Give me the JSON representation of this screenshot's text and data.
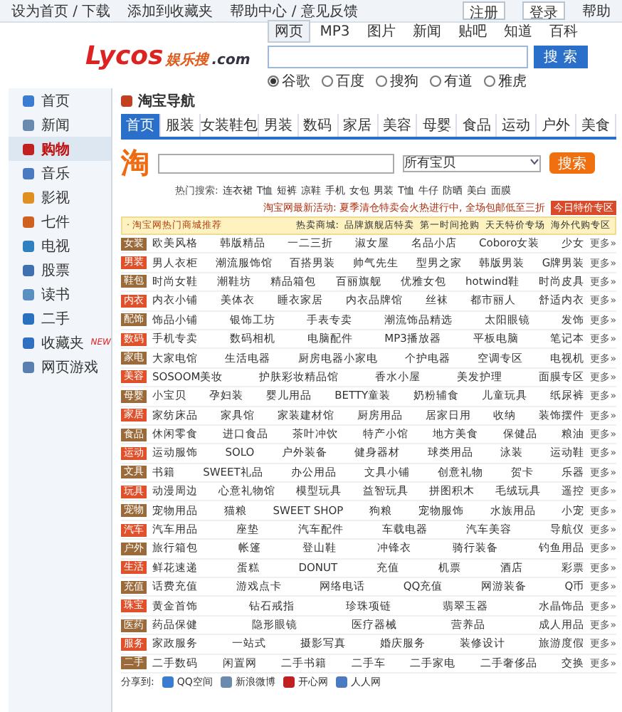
{
  "top_links": [
    "设为首页 / 下载",
    "添加到收藏夹",
    "帮助中心 / 意见反馈"
  ],
  "account_buttons": [
    "注册",
    "登录"
  ],
  "help": "帮助",
  "logo": {
    "word": "Lycos",
    "cn": "娱乐搜",
    "domain": ".com"
  },
  "search_tabs": [
    {
      "label": "网页",
      "selected": true
    },
    {
      "label": "MP3",
      "selected": false
    },
    {
      "label": "图片",
      "selected": false
    },
    {
      "label": "新闻",
      "selected": false
    },
    {
      "label": "贴吧",
      "selected": false
    },
    {
      "label": "知道",
      "selected": false
    },
    {
      "label": "百科",
      "selected": false
    }
  ],
  "search_button": "搜 索",
  "engines": [
    {
      "label": "谷歌",
      "selected": true
    },
    {
      "label": "百度",
      "selected": false
    },
    {
      "label": "搜狗",
      "selected": false
    },
    {
      "label": "有道",
      "selected": false
    },
    {
      "label": "雅虎",
      "selected": false
    }
  ],
  "sidebar": [
    {
      "label": "首页",
      "selected": false
    },
    {
      "label": "新闻",
      "selected": false
    },
    {
      "label": "购物",
      "selected": true
    },
    {
      "label": "音乐",
      "selected": false
    },
    {
      "label": "影视",
      "selected": false
    },
    {
      "label": "七件",
      "selected": false
    },
    {
      "label": "电视",
      "selected": false
    },
    {
      "label": "股票",
      "selected": false
    },
    {
      "label": "读书",
      "selected": false
    },
    {
      "label": "二手",
      "selected": false
    },
    {
      "label": "收藏夹",
      "selected": false,
      "badge": "NEW"
    },
    {
      "label": "网页游戏",
      "selected": false
    }
  ],
  "page_title": "淘宝导航",
  "category_tabs": [
    {
      "label": "首页",
      "selected": true
    },
    {
      "label": "服装",
      "selected": false
    },
    {
      "label": "女装鞋包",
      "selected": false
    },
    {
      "label": "男装",
      "selected": false
    },
    {
      "label": "数码",
      "selected": false
    },
    {
      "label": "家居",
      "selected": false
    },
    {
      "label": "美容",
      "selected": false
    },
    {
      "label": "母婴",
      "selected": false
    },
    {
      "label": "食品",
      "selected": false
    },
    {
      "label": "运动",
      "selected": false
    },
    {
      "label": "户外",
      "selected": false
    },
    {
      "label": "美食",
      "selected": false
    }
  ],
  "taobao": {
    "logo": "淘",
    "select": "所有宝贝",
    "button": "搜索",
    "hot_words": [
      "热门搜索:",
      "连衣裙",
      "T恤",
      "短裤",
      "凉鞋",
      "手机",
      "女包",
      "男装",
      "T恤",
      "牛仔",
      "防晒",
      "美白",
      "面膜"
    ]
  },
  "notice": {
    "text": "淘宝网最新活动: 夏季清仓特卖会火热进行中, 全场包邮低至三折",
    "tag": "今日特价专区"
  },
  "hot_bar": {
    "title": "· 淘宝网热门商城推荐",
    "links": [
      "热卖商城:",
      "品牌旗舰店特卖",
      "第一时间抢购",
      "天天特价专场",
      "海外代购专区"
    ]
  },
  "rows": [
    {
      "category": "女装",
      "color": "#9a6a3a",
      "links": [
        "欧美风格",
        "韩版精品",
        "一二三折",
        "淑女屋",
        "名品小店",
        "Coboro女装",
        "少女"
      ],
      "more": "更多»"
    },
    {
      "category": "男装",
      "color": "#e0502a",
      "links": [
        "男人衣柜",
        "潮流服饰馆",
        "百搭男装",
        "帅气先生",
        "型男之家",
        "韩版男装",
        "G牌男装"
      ],
      "more": "更多»"
    },
    {
      "category": "鞋包",
      "color": "#9a6a3a",
      "links": [
        "时尚女鞋",
        "潮鞋坊",
        "精品箱包",
        "百丽旗舰",
        "优雅女包",
        "hotwind鞋",
        "时尚皮具"
      ],
      "more": "更多»"
    },
    {
      "category": "内衣",
      "color": "#e0502a",
      "links": [
        "内衣小铺",
        "美体衣",
        "睡衣家居",
        "内衣品牌馆",
        "丝袜",
        "都市丽人",
        "舒适内衣"
      ],
      "more": "更多»"
    },
    {
      "category": "配饰",
      "color": "#9a6a3a",
      "links": [
        "饰品小铺",
        "银饰工坊",
        "手表专卖",
        "潮流饰品精选",
        "太阳眼镜",
        "发饰"
      ],
      "more": "更多»"
    },
    {
      "category": "数码",
      "color": "#e0502a",
      "links": [
        "手机专卖",
        "数码相机",
        "电脑配件",
        "MP3播放器",
        "平板电脑",
        "笔记本"
      ],
      "more": "更多»"
    },
    {
      "category": "家电",
      "color": "#9a6a3a",
      "links": [
        "大家电馆",
        "生活电器",
        "厨房电器小家电",
        "个护电器",
        "空调专区",
        "电视机"
      ],
      "more": "更多»"
    },
    {
      "category": "美容",
      "color": "#e0502a",
      "links": [
        "SOSOOM美妆",
        "护肤彩妆精品馆",
        "香水小屋",
        "美发护理",
        "面膜专区"
      ],
      "more": "更多»"
    },
    {
      "category": "母婴",
      "color": "#9a6a3a",
      "links": [
        "小宝贝",
        "孕妇装",
        "婴儿用品",
        "BETTY童装",
        "奶粉辅食",
        "儿童玩具",
        "纸尿裤"
      ],
      "more": "更多»"
    },
    {
      "category": "家居",
      "color": "#e0502a",
      "links": [
        "家纺床品",
        "家具馆",
        "家装建材馆",
        "厨房用品",
        "居家日用",
        "收纳",
        "装饰摆件"
      ],
      "more": "更多»"
    },
    {
      "category": "食品",
      "color": "#9a6a3a",
      "links": [
        "休闲零食",
        "进口食品",
        "茶叶冲饮",
        "特产小馆",
        "地方美食",
        "保健品",
        "粮油"
      ],
      "more": "更多»"
    },
    {
      "category": "运动",
      "color": "#e0502a",
      "links": [
        "运动服饰",
        "SOLO",
        "户外装备",
        "健身器材",
        "球类用品",
        "泳装",
        "运动鞋"
      ],
      "more": "更多»"
    },
    {
      "category": "文具",
      "color": "#9a6a3a",
      "links": [
        "书籍",
        "SWEET礼品",
        "办公用品",
        "文具小铺",
        "创意礼物",
        "贺卡",
        "乐器"
      ],
      "more": "更多»"
    },
    {
      "category": "玩具",
      "color": "#e0502a",
      "links": [
        "动漫周边",
        "心意礼物馆",
        "模型玩具",
        "益智玩具",
        "拼图积木",
        "毛绒玩具",
        "遥控"
      ],
      "more": "更多»"
    },
    {
      "category": "宠物",
      "color": "#9a6a3a",
      "links": [
        "宠物用品",
        "猫粮",
        "SWEET SHOP",
        "狗粮",
        "宠物服饰",
        "水族用品",
        "小宠"
      ],
      "more": "更多»"
    },
    {
      "category": "汽车",
      "color": "#e0502a",
      "links": [
        "汽车用品",
        "座垫",
        "汽车配件",
        "车载电器",
        "汽车美容",
        "导航仪"
      ],
      "more": "更多»"
    },
    {
      "category": "户外",
      "color": "#9a6a3a",
      "links": [
        "旅行箱包",
        "帐篷",
        "登山鞋",
        "冲锋衣",
        "骑行装备",
        "钓鱼用品"
      ],
      "more": "更多»"
    },
    {
      "category": "生活",
      "color": "#e0502a",
      "links": [
        "鲜花速递",
        "蛋糕",
        "DONUT",
        "充值",
        "机票",
        "酒店",
        "彩票"
      ],
      "more": "更多»"
    },
    {
      "category": "充值",
      "color": "#9a6a3a",
      "links": [
        "话费充值",
        "游戏点卡",
        "网络电话",
        "QQ充值",
        "网游装备",
        "Q币"
      ],
      "more": "更多»"
    },
    {
      "category": "珠宝",
      "color": "#e0502a",
      "links": [
        "黄金首饰",
        "钻石戒指",
        "珍珠项链",
        "翡翠玉器",
        "水晶饰品"
      ],
      "more": "更多»"
    },
    {
      "category": "医药",
      "color": "#9a6a3a",
      "links": [
        "药品保健",
        "隐形眼镜",
        "医疗器械",
        "营养品",
        "成人用品"
      ],
      "more": "更多»"
    },
    {
      "category": "服务",
      "color": "#e0502a",
      "links": [
        "家政服务",
        "一站式",
        "摄影写真",
        "婚庆服务",
        "装修设计",
        "旅游度假"
      ],
      "more": "更多»"
    },
    {
      "category": "二手",
      "color": "#9a6a3a",
      "links": [
        "二手数码",
        "闲置网",
        "二手书籍",
        "二手车",
        "二手家电",
        "二手奢侈品",
        "交换"
      ],
      "more": "更多»"
    }
  ],
  "share": {
    "label": "分享到:",
    "targets": [
      "QQ空间",
      "新浪微博",
      "开心网",
      "人人网"
    ]
  }
}
